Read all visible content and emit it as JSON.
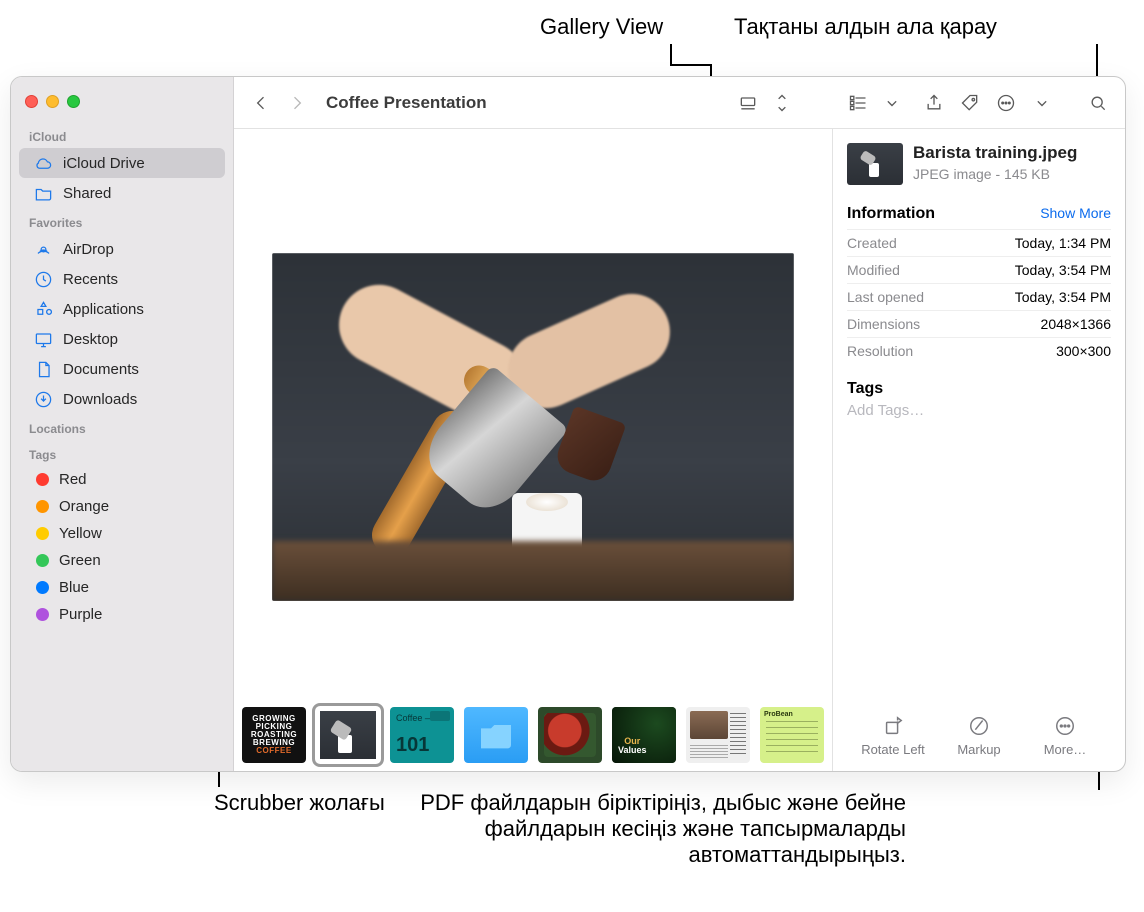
{
  "callouts": {
    "gallery_view": "Gallery View",
    "preview_board": "Тақтаны алдын ала қарау",
    "scrubber": "Scrubber жолағы",
    "bottom_note": "PDF файлдарын біріктіріңіз, дыбыс және бейне файлдарын кесіңіз және тапсырмаларды автоматтандырыңыз."
  },
  "toolbar": {
    "title": "Coffee Presentation"
  },
  "sidebar": {
    "sections": {
      "icloud": {
        "label": "iCloud",
        "items": [
          "iCloud Drive",
          "Shared"
        ]
      },
      "favorites": {
        "label": "Favorites",
        "items": [
          "AirDrop",
          "Recents",
          "Applications",
          "Desktop",
          "Documents",
          "Downloads"
        ]
      },
      "locations": {
        "label": "Locations"
      },
      "tags": {
        "label": "Tags",
        "items": [
          {
            "label": "Red",
            "color": "#ff3b30"
          },
          {
            "label": "Orange",
            "color": "#ff9500"
          },
          {
            "label": "Yellow",
            "color": "#ffcc00"
          },
          {
            "label": "Green",
            "color": "#34c759"
          },
          {
            "label": "Blue",
            "color": "#007aff"
          },
          {
            "label": "Purple",
            "color": "#af52de"
          }
        ]
      }
    }
  },
  "preview": {
    "filename": "Barista training.jpeg",
    "subtitle": "JPEG image - 145 KB",
    "info_label": "Information",
    "show_more": "Show More",
    "rows": [
      {
        "k": "Created",
        "v": "Today, 1:34 PM"
      },
      {
        "k": "Modified",
        "v": "Today, 3:54 PM"
      },
      {
        "k": "Last opened",
        "v": "Today, 3:54 PM"
      },
      {
        "k": "Dimensions",
        "v": "2048×1366"
      },
      {
        "k": "Resolution",
        "v": "300×300"
      }
    ],
    "tags_label": "Tags",
    "add_tags": "Add Tags…",
    "actions": {
      "rotate": "Rotate Left",
      "markup": "Markup",
      "more": "More…"
    }
  },
  "scrubber_thumbs": [
    {
      "caption": "GROWING PICKING ROASTING BREWING COFFEE"
    },
    {
      "caption": ""
    },
    {
      "caption": "Coffee – 101"
    },
    {
      "caption": ""
    },
    {
      "caption": ""
    },
    {
      "caption": "Our Values"
    },
    {
      "caption": ""
    },
    {
      "caption": ""
    }
  ]
}
